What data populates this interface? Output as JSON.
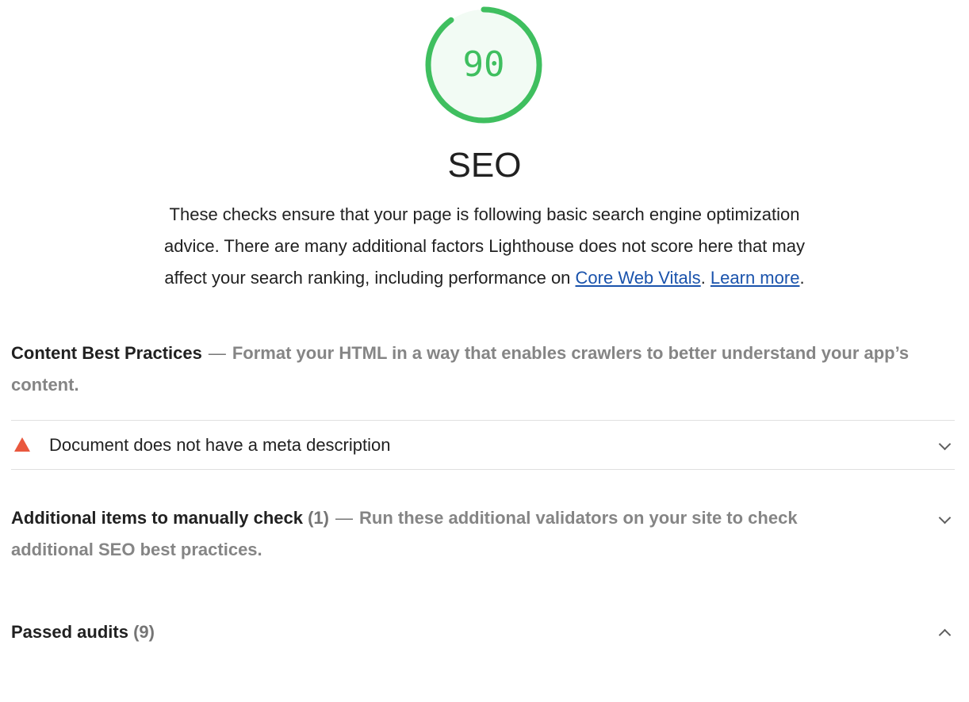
{
  "gauge": {
    "score": "90",
    "score_fraction": 0.9,
    "color": "#3fbf5f"
  },
  "category": {
    "title": "SEO",
    "description_before": "These checks ensure that your page is following basic search engine optimization advice. There are many additional factors Lighthouse does not score here that may affect your search ranking, including performance on ",
    "link_core_web_vitals": "Core Web Vitals",
    "separator": ". ",
    "link_learn_more": "Learn more",
    "description_end": "."
  },
  "groups": {
    "content": {
      "title": "Content Best Practices",
      "separator": "—",
      "description": "Format your HTML in a way that enables crawlers to better understand your app’s content."
    },
    "manual": {
      "title": "Additional items to manually check",
      "count": "(1)",
      "separator": "—",
      "description": "Run these additional validators on your site to check additional SEO best practices."
    },
    "passed": {
      "title": "Passed audits",
      "count": "(9)"
    }
  },
  "audits": [
    {
      "title": "Document does not have a meta description",
      "status": "fail",
      "icon": "warning-triangle-icon",
      "icon_color": "#e9583e"
    }
  ],
  "icons": {
    "expand": "chevron-down-icon",
    "collapse": "chevron-up-icon"
  }
}
